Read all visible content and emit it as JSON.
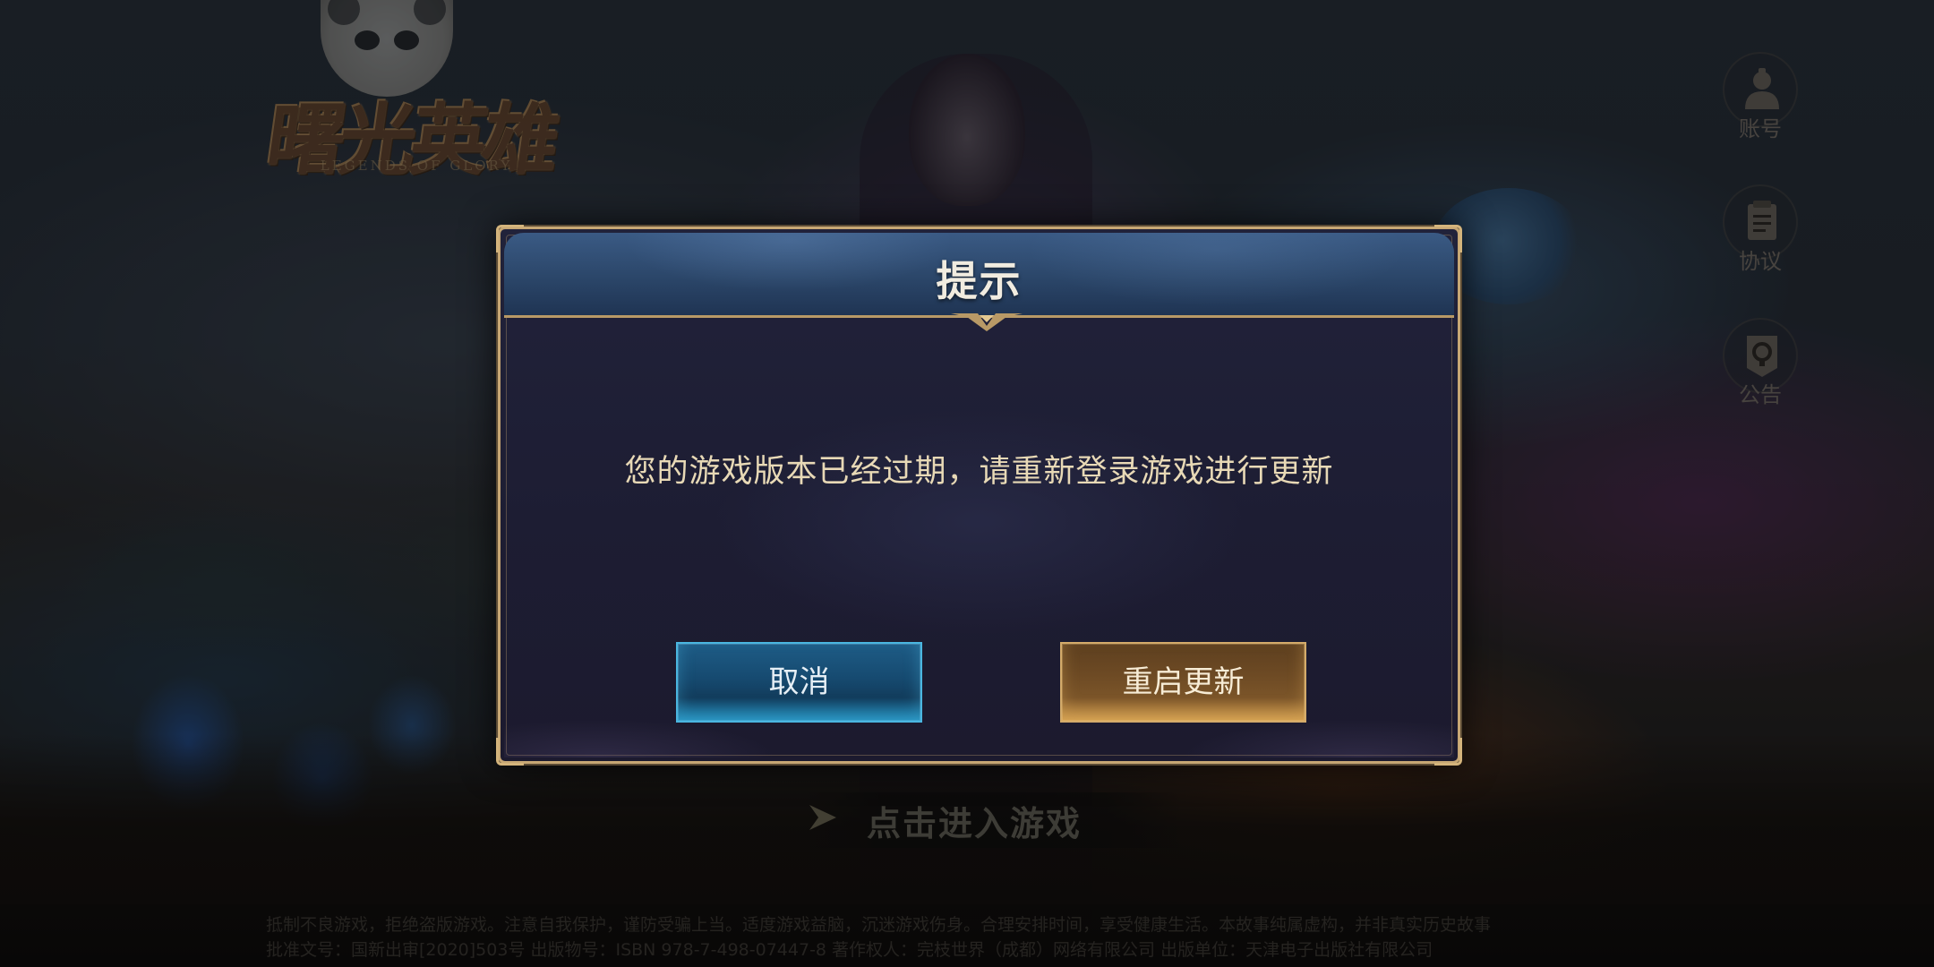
{
  "logo": {
    "title": "曙光英雄",
    "subtitle": "LEGENDS OF GLORY"
  },
  "side_menu": {
    "items": [
      {
        "label": "账号",
        "icon": "account-icon"
      },
      {
        "label": "协议",
        "icon": "document-icon"
      },
      {
        "label": "公告",
        "icon": "announcement-icon"
      }
    ]
  },
  "enter_game": {
    "label": "点击进入游戏",
    "icon": "arrow-right-icon"
  },
  "dialog": {
    "title": "提示",
    "message": "您的游戏版本已经过期，请重新登录游戏进行更新",
    "cancel_label": "取消",
    "confirm_label": "重启更新"
  },
  "footer": {
    "line1": "抵制不良游戏，拒绝盗版游戏。注意自我保护，谨防受骗上当。适度游戏益脑，沉迷游戏伤身。合理安排时间，享受健康生活。本故事纯属虚构，并非真实历史故事",
    "line2": "批准文号：国新出审[2020]503号 出版物号：ISBN 978-7-498-07447-8 著作权人：完枝世界（成都）网络有限公司 出版单位：天津电子出版社有限公司"
  },
  "colors": {
    "dialog_border": "#c7a774",
    "header_blue": "#2b4669",
    "cancel_blue": "#1a7fae",
    "confirm_gold": "#c9954a",
    "message_text": "#e8d9b6"
  }
}
